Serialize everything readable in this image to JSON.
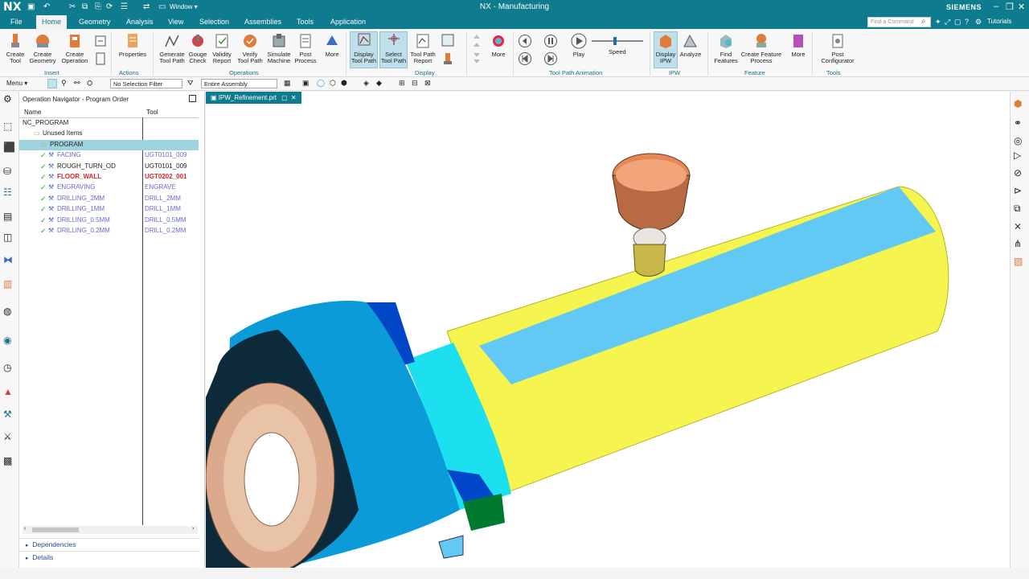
{
  "titlebar": {
    "logo": "NX",
    "window_label": "Window ▾",
    "title": "NX - Manufacturing",
    "brand": "SIEMENS",
    "tutorials": "Tutorials",
    "find_command_placeholder": "Find a Command"
  },
  "menus": [
    "File",
    "Home",
    "Geometry",
    "Analysis",
    "View",
    "Selection",
    "Assemblies",
    "Tools",
    "Application"
  ],
  "ribbon": {
    "buttons": [
      {
        "label": "Create\nTool",
        "icon": "create-tool-icon"
      },
      {
        "label": "Create\nGeometry",
        "icon": "create-geometry-icon"
      },
      {
        "label": "Create\nOperation",
        "icon": "create-operation-icon"
      },
      {
        "label": "Properties",
        "icon": "properties-icon"
      },
      {
        "label": "Generate\nTool Path",
        "icon": "generate-tool-path-icon"
      },
      {
        "label": "Gouge\nCheck",
        "icon": "gouge-check-icon"
      },
      {
        "label": "Validity\nReport",
        "icon": "validity-report-icon"
      },
      {
        "label": "Verify\nTool Path",
        "icon": "verify-tool-path-icon"
      },
      {
        "label": "Simulate\nMachine",
        "icon": "simulate-machine-icon"
      },
      {
        "label": "Post\nProcess",
        "icon": "post-process-icon"
      },
      {
        "label": "More",
        "icon": "more-icon"
      },
      {
        "label": "Display\nTool Path",
        "icon": "display-tool-path-icon"
      },
      {
        "label": "Select\nTool Path",
        "icon": "select-tool-path-icon"
      },
      {
        "label": "Tool Path\nReport",
        "icon": "tool-path-report-icon"
      },
      {
        "label": "More",
        "icon": "more-icon"
      },
      {
        "label": "Play",
        "icon": "play-icon"
      },
      {
        "label": "Speed",
        "icon": "speed-slider-icon"
      },
      {
        "label": "Display\nIPW",
        "icon": "display-ipw-icon"
      },
      {
        "label": "Analyze",
        "icon": "analyze-icon"
      },
      {
        "label": "Find\nFeatures",
        "icon": "find-features-icon"
      },
      {
        "label": "Create Feature\nProcess",
        "icon": "create-feature-process-icon"
      },
      {
        "label": "More",
        "icon": "more-icon"
      },
      {
        "label": "Post\nConfigurator",
        "icon": "post-configurator-icon"
      }
    ],
    "groups": [
      "Insert",
      "Actions",
      "Operations",
      "Display",
      "Tool Path Animation",
      "IPW",
      "Feature",
      "Tools"
    ]
  },
  "toolbar2": {
    "menu_label": "Menu ▾",
    "selection_filter": "No Selection Filter",
    "assembly_scope": "Entire Assembly"
  },
  "navigator": {
    "title": "Operation Navigator - Program Order",
    "columns": [
      "Name",
      "Tool"
    ],
    "rows": [
      {
        "name": "NC_PROGRAM",
        "tool": "",
        "indent": 0,
        "style": "normal"
      },
      {
        "name": "Unused Items",
        "tool": "",
        "indent": 1,
        "style": "normal"
      },
      {
        "name": "PROGRAM",
        "tool": "",
        "indent": 2,
        "style": "selected"
      },
      {
        "name": "FACING",
        "tool": "UGT0101_009",
        "indent": 3,
        "style": "dim"
      },
      {
        "name": "ROUGH_TURN_OD",
        "tool": "UGT0101_009",
        "indent": 3,
        "style": "normal"
      },
      {
        "name": "FLOOR_WALL",
        "tool": "UGT0202_001",
        "indent": 3,
        "style": "red"
      },
      {
        "name": "ENGRAVING",
        "tool": "ENGRAVE",
        "indent": 3,
        "style": "dim"
      },
      {
        "name": "DRILLING_2MM",
        "tool": "DRILL_2MM",
        "indent": 3,
        "style": "dim"
      },
      {
        "name": "DRILLING_1MM",
        "tool": "DRILL_1MM",
        "indent": 3,
        "style": "dim"
      },
      {
        "name": "DRILLING_0.5MM",
        "tool": "DRILL_0.5MM",
        "indent": 3,
        "style": "dim"
      },
      {
        "name": "DRILLING_0.2MM",
        "tool": "DRILL_0.2MM",
        "indent": 3,
        "style": "dim"
      }
    ],
    "panels": [
      "Dependencies",
      "Details"
    ]
  },
  "document_tab": "IPW_Refinement.prt",
  "colors": {
    "accent": "#0e7c8e",
    "selected_row": "#9fd3e0",
    "error_text": "#d12a2a",
    "dim_text": "#6a6ad0",
    "part_yellow": "#f6f44e",
    "part_cyan": "#62c9f5",
    "part_blue": "#0a9bd8",
    "part_copper": "#dba98c",
    "tool_orange": "#e58855"
  }
}
